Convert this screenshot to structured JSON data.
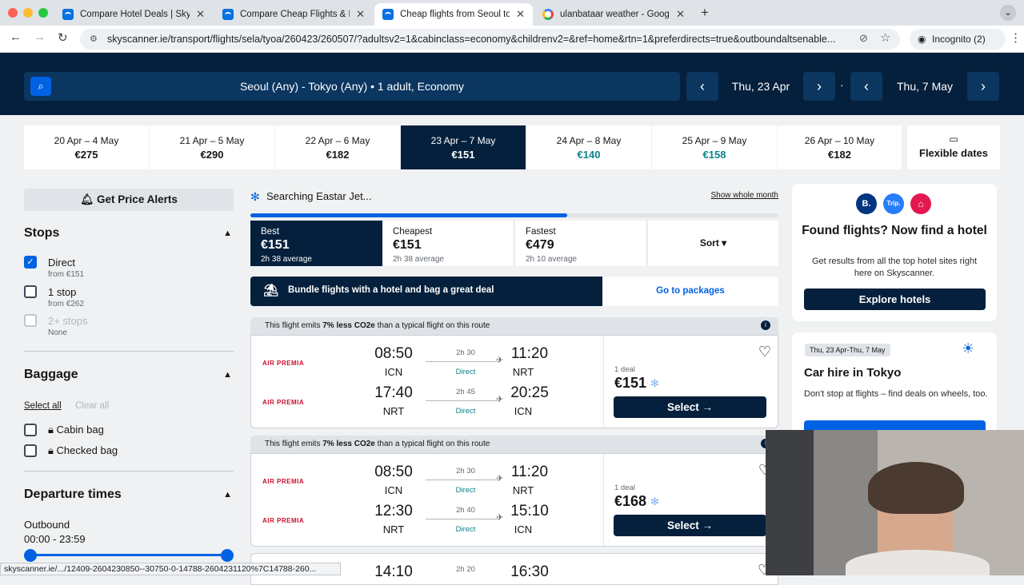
{
  "browser": {
    "tabs": [
      {
        "title": "Compare Hotel Deals | Skysca",
        "icon": "skyscanner-icon"
      },
      {
        "title": "Compare Cheap Flights & Boo",
        "icon": "skyscanner-icon"
      },
      {
        "title": "Cheap flights from Seoul to To",
        "icon": "skyscanner-icon"
      },
      {
        "title": "ulanbataar weather - Google",
        "icon": "google-icon"
      }
    ],
    "url": "skyscanner.ie/transport/flights/sela/tyoa/260423/260507/?adultsv2=1&cabinclass=economy&childrenv2=&ref=home&rtn=1&preferdirects=true&outboundaltsenable...",
    "incognito": "Incognito (2)",
    "status_url": "skyscanner.ie/.../12409-2604230850--30750-0-14788-2604231120%7C14788-260..."
  },
  "search": {
    "summary": "Seoul (Any) - Tokyo (Any)  •  1 adult, Economy",
    "depart": "Thu, 23 Apr",
    "return": "Thu, 7 May",
    "separator": "·"
  },
  "date_options": [
    {
      "range": "20 Apr – 4 May",
      "price": "€275"
    },
    {
      "range": "21 Apr – 5 May",
      "price": "€290"
    },
    {
      "range": "22 Apr – 6 May",
      "price": "€182"
    },
    {
      "range": "23 Apr – 7 May",
      "price": "€151"
    },
    {
      "range": "24 Apr – 8 May",
      "price": "€140"
    },
    {
      "range": "25 Apr – 9 May",
      "price": "€158"
    },
    {
      "range": "26 Apr – 10 May",
      "price": "€182"
    }
  ],
  "flexible": "Flexible dates",
  "filters": {
    "price_alerts": "Get Price Alerts",
    "stops_title": "Stops",
    "stops": [
      {
        "label": "Direct",
        "sub": "from €151"
      },
      {
        "label": "1 stop",
        "sub": "from €262"
      },
      {
        "label": "2+ stops",
        "sub": "None"
      }
    ],
    "baggage_title": "Baggage",
    "select_all": "Select all",
    "clear_all": "Clear all",
    "bags": [
      "Cabin bag",
      "Checked bag"
    ],
    "departure_title": "Departure times",
    "outbound": "Outbound",
    "outbound_range": "00:00 - 23:59"
  },
  "results": {
    "searching": "Searching Eastar Jet...",
    "whole_month": "Show whole month",
    "progress": 0.6,
    "sort_tabs": [
      {
        "name": "Best",
        "price": "€151",
        "avg": "2h 38 average"
      },
      {
        "name": "Cheapest",
        "price": "€151",
        "avg": "2h 38 average"
      },
      {
        "name": "Fastest",
        "price": "€479",
        "avg": "2h 10 average"
      }
    ],
    "sort": "Sort",
    "bundle": "Bundle flights with a hotel and bag a great deal",
    "packages": "Go to packages",
    "emission_pre": "This flight emits ",
    "emission_bold": "7% less CO2e",
    "emission_post": " than a typical flight on this route",
    "airline": "AIR PREMIA",
    "flights": [
      {
        "legs": [
          {
            "dep": "08:50",
            "from": "ICN",
            "dur": "2h 30",
            "stops": "Direct",
            "arr": "11:20",
            "to": "NRT"
          },
          {
            "dep": "17:40",
            "from": "NRT",
            "dur": "2h 45",
            "stops": "Direct",
            "arr": "20:25",
            "to": "ICN"
          }
        ],
        "deals": "1 deal",
        "price": "€151",
        "select": "Select"
      },
      {
        "legs": [
          {
            "dep": "08:50",
            "from": "ICN",
            "dur": "2h 30",
            "stops": "Direct",
            "arr": "11:20",
            "to": "NRT"
          },
          {
            "dep": "12:30",
            "from": "NRT",
            "dur": "2h 40",
            "stops": "Direct",
            "arr": "15:10",
            "to": "ICN"
          }
        ],
        "deals": "1 deal",
        "price": "€168",
        "select": "Select"
      },
      {
        "legs": [
          {
            "dep": "14:10",
            "dur": "2h 20",
            "arr": "16:30"
          }
        ]
      }
    ]
  },
  "hotel_promo": {
    "title": "Found flights? Now find a hotel",
    "body": "Get results from all the top hotel sites right here on Skyscanner.",
    "button": "Explore hotels",
    "logos": [
      "B.",
      "Trip."
    ]
  },
  "car_promo": {
    "dates": "Thu, 23 Apr-Thu, 7 May",
    "title": "Car hire in Tokyo",
    "body": "Don't stop at flights – find deals on wheels, too."
  },
  "colors": {
    "navy": "#05203c",
    "blue": "#0062e3",
    "teal": "#0c838a"
  }
}
